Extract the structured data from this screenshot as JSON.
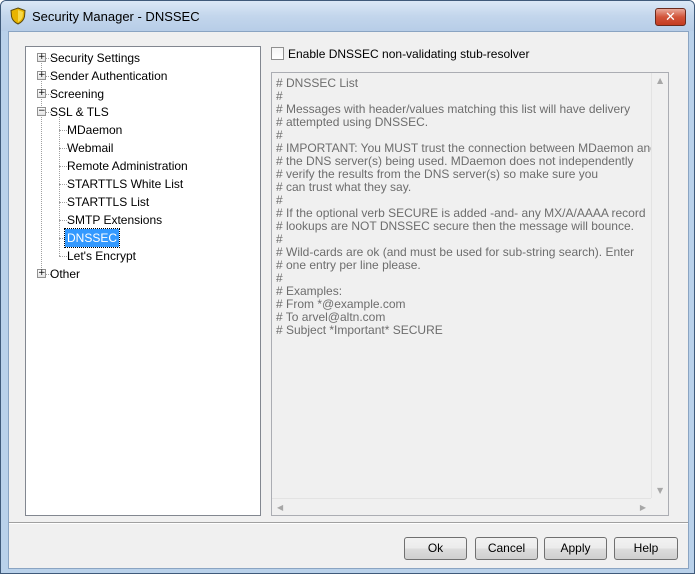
{
  "window": {
    "title": "Security Manager - DNSSEC",
    "close_glyph": "✕"
  },
  "tree": {
    "items": [
      {
        "label": "Security Settings",
        "expander": "+"
      },
      {
        "label": "Sender Authentication",
        "expander": "+"
      },
      {
        "label": "Screening",
        "expander": "+"
      },
      {
        "label": "SSL & TLS",
        "expander": "−"
      },
      {
        "label": "MDaemon"
      },
      {
        "label": "Webmail"
      },
      {
        "label": "Remote Administration"
      },
      {
        "label": "STARTTLS White List"
      },
      {
        "label": "STARTTLS List"
      },
      {
        "label": "SMTP Extensions"
      },
      {
        "label": "DNSSEC",
        "selected": true
      },
      {
        "label": "Let's Encrypt"
      },
      {
        "label": "Other",
        "expander": "+"
      }
    ]
  },
  "checkbox": {
    "label": "Enable DNSSEC non-validating stub-resolver",
    "checked": false
  },
  "editor": {
    "lines": [
      "# DNSSEC List",
      "#",
      "# Messages with header/values matching this list will have delivery",
      "# attempted using DNSSEC.",
      "#",
      "# IMPORTANT: You MUST trust the connection between MDaemon and",
      "# the DNS server(s) being used. MDaemon does not independently",
      "# verify the results from the DNS server(s) so make sure you",
      "# can trust what they say.",
      "#",
      "# If the optional verb SECURE is added -and- any MX/A/AAAA record",
      "# lookups are NOT DNSSEC secure then the message will bounce.",
      "#",
      "# Wild-cards are ok (and must be used for sub-string search). Enter",
      "# one entry per line please.",
      "#",
      "# Examples:",
      "# From *@example.com",
      "# To arvel@altn.com",
      "# Subject *Important* SECURE"
    ]
  },
  "buttons": {
    "ok": "Ok",
    "cancel": "Cancel",
    "apply": "Apply",
    "help": "Help"
  },
  "icons": {
    "app": "shield-icon"
  }
}
